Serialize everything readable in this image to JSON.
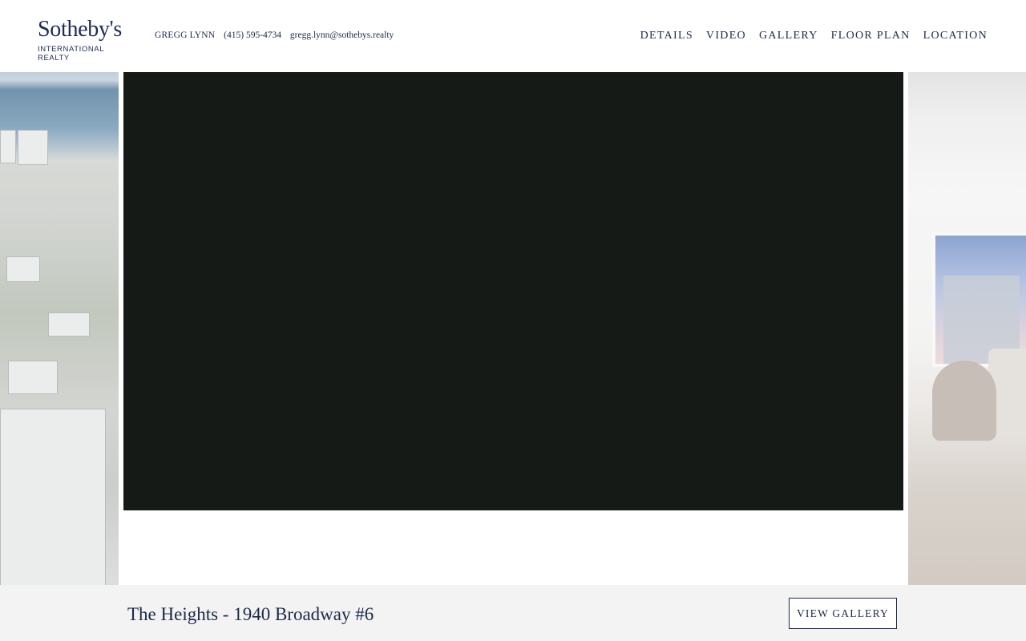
{
  "brand": {
    "name": "Sotheby's",
    "subtitle": "INTERNATIONAL REALTY"
  },
  "agent": {
    "name": "GREGG LYNN",
    "phone": "(415) 595-4734",
    "email": "gregg.lynn@sothebys.realty"
  },
  "nav": [
    "DETAILS",
    "VIDEO",
    "GALLERY",
    "FLOOR PLAN",
    "LOCATION"
  ],
  "listing": {
    "title": "The Heights - 1940 Broadway #6"
  },
  "actions": {
    "view_gallery": "VIEW GALLERY"
  },
  "colors": {
    "brand_navy": "#1c2a4a",
    "video_bg": "#151a17",
    "bar_bg": "#f3f3f3"
  }
}
